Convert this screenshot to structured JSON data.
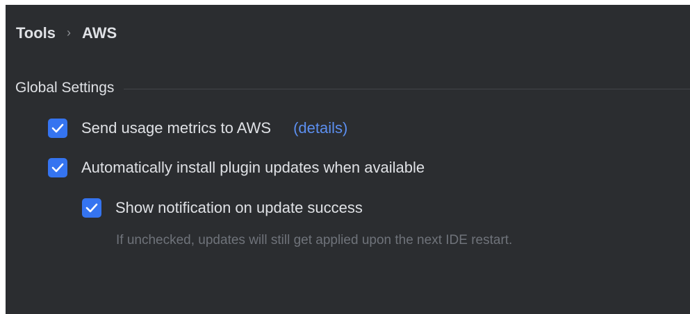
{
  "breadcrumb": {
    "parent": "Tools",
    "separator": "›",
    "current": "AWS"
  },
  "global_settings": {
    "title": "Global Settings",
    "send_metrics": {
      "label": "Send usage metrics to AWS",
      "checked": true,
      "details_link": "(details)"
    },
    "auto_install": {
      "label": "Automatically install plugin updates when available",
      "checked": true
    },
    "show_notification": {
      "label": "Show notification on update success",
      "checked": true,
      "hint": "If unchecked, updates will still get applied upon the next IDE restart."
    }
  },
  "colors": {
    "panel_background": "#2b2d30",
    "text": "#dfe1e5",
    "checkbox_accent": "#3574f0",
    "link": "#5c8ff0",
    "hint_text": "#6f737a"
  },
  "icons": {
    "checkmark": "check-icon",
    "breadcrumb_separator": "chevron-right-icon"
  }
}
